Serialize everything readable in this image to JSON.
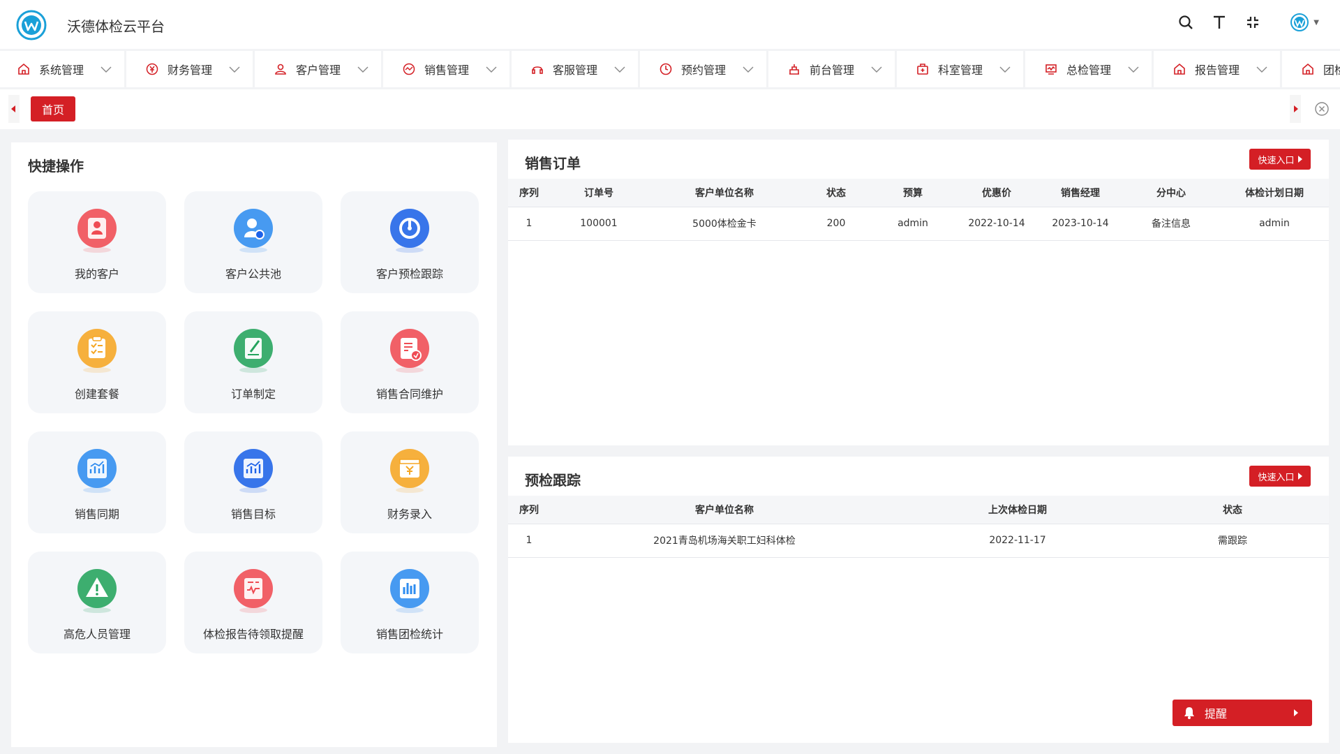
{
  "app": {
    "title": "沃德体检云平台"
  },
  "colors": {
    "brand": "#d41f25",
    "logo": "#1aa0d8",
    "background": "#f2f3f5"
  },
  "header": {
    "tools": [
      {
        "name": "search-icon"
      },
      {
        "name": "font-size-icon"
      },
      {
        "name": "fullscreen-icon"
      }
    ]
  },
  "nav": {
    "items": [
      {
        "label": "系统管理",
        "icon": "home-icon"
      },
      {
        "label": "财务管理",
        "icon": "yen-icon"
      },
      {
        "label": "客户管理",
        "icon": "user-icon"
      },
      {
        "label": "销售管理",
        "icon": "sales-icon"
      },
      {
        "label": "客服管理",
        "icon": "headset-icon"
      },
      {
        "label": "预约管理",
        "icon": "clock-icon"
      },
      {
        "label": "前台管理",
        "icon": "reception-icon"
      },
      {
        "label": "科室管理",
        "icon": "medkit-icon"
      },
      {
        "label": "总检管理",
        "icon": "monitor-icon"
      },
      {
        "label": "报告管理",
        "icon": "home-icon"
      },
      {
        "label": "团检",
        "icon": "home-icon"
      }
    ]
  },
  "tabs": {
    "home_label": "首页"
  },
  "quick": {
    "title": "快捷操作",
    "items": [
      {
        "label": "我的客户",
        "icon": "my-customer-icon",
        "color": "#ef4b53"
      },
      {
        "label": "客户公共池",
        "icon": "customer-pool-icon",
        "color": "#2e8cf0"
      },
      {
        "label": "客户预检跟踪",
        "icon": "pre-check-track-icon",
        "color": "#1d62e8"
      },
      {
        "label": "创建套餐",
        "icon": "create-package-icon",
        "color": "#f5a623"
      },
      {
        "label": "订单制定",
        "icon": "order-create-icon",
        "color": "#23a35c"
      },
      {
        "label": "销售合同维护",
        "icon": "contract-icon",
        "color": "#ef4b53"
      },
      {
        "label": "销售同期",
        "icon": "sales-period-icon",
        "color": "#2e8cf0"
      },
      {
        "label": "销售目标",
        "icon": "sales-target-icon",
        "color": "#1d62e8"
      },
      {
        "label": "财务录入",
        "icon": "finance-entry-icon",
        "color": "#f5a623"
      },
      {
        "label": "高危人员管理",
        "icon": "high-risk-icon",
        "color": "#23a35c"
      },
      {
        "label": "体检报告待领取提醒",
        "icon": "report-reminder-icon",
        "color": "#ef4b53"
      },
      {
        "label": "销售团检统计",
        "icon": "group-stats-icon",
        "color": "#2e8cf0"
      }
    ]
  },
  "sales_orders": {
    "title": "销售订单",
    "entry_label": "快速入口",
    "columns": [
      "序列",
      "订单号",
      "客户单位名称",
      "状态",
      "预算",
      "优惠价",
      "销售经理",
      "分中心",
      "体检计划日期"
    ],
    "rows": [
      [
        "1",
        "100001",
        "5000体检金卡",
        "200",
        "admin",
        "2022-10-14",
        "2023-10-14",
        "备注信息",
        "admin"
      ]
    ]
  },
  "pre_check": {
    "title": "预检跟踪",
    "entry_label": "快速入口",
    "columns": [
      "序列",
      "客户单位名称",
      "上次体检日期",
      "状态"
    ],
    "rows": [
      [
        "1",
        "2021青岛机场海关职工妇科体检",
        "2022-11-17",
        "需跟踪"
      ]
    ]
  },
  "remind": {
    "label": "提醒"
  }
}
